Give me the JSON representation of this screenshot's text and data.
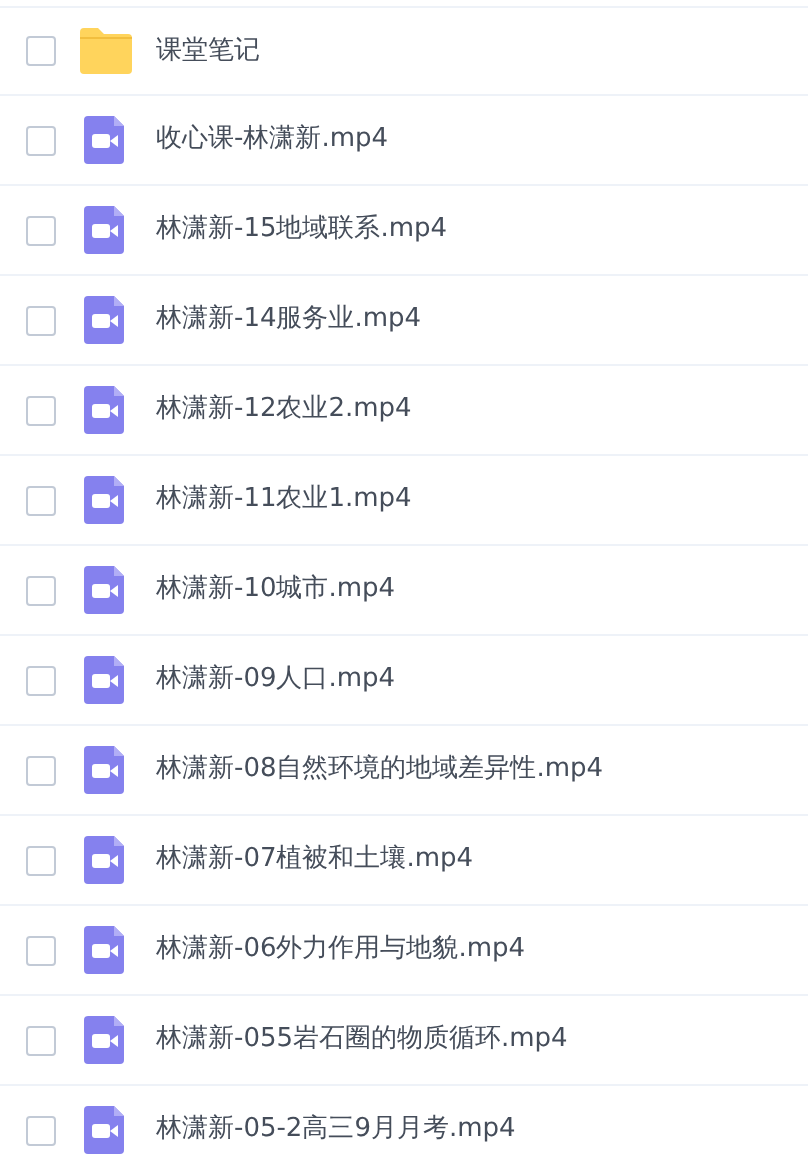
{
  "files": [
    {
      "kind": "folder",
      "name": "课堂笔记",
      "checked": false
    },
    {
      "kind": "video",
      "name": "收心课-林潇新.mp4",
      "checked": false
    },
    {
      "kind": "video",
      "name": "林潇新-15地域联系.mp4",
      "checked": false
    },
    {
      "kind": "video",
      "name": "林潇新-14服务业.mp4",
      "checked": false
    },
    {
      "kind": "video",
      "name": "林潇新-12农业2.mp4",
      "checked": false
    },
    {
      "kind": "video",
      "name": "林潇新-11农业1.mp4",
      "checked": false
    },
    {
      "kind": "video",
      "name": "林潇新-10城市.mp4",
      "checked": false
    },
    {
      "kind": "video",
      "name": "林潇新-09人口.mp4",
      "checked": false
    },
    {
      "kind": "video",
      "name": "林潇新-08自然环境的地域差异性.mp4",
      "checked": false
    },
    {
      "kind": "video",
      "name": "林潇新-07植被和土壤.mp4",
      "checked": false
    },
    {
      "kind": "video",
      "name": "林潇新-06外力作用与地貌.mp4",
      "checked": false
    },
    {
      "kind": "video",
      "name": "林潇新-055岩石圈的物质循环.mp4",
      "checked": false
    },
    {
      "kind": "video",
      "name": "林潇新-05-2高三9月月考.mp4",
      "checked": false
    }
  ]
}
